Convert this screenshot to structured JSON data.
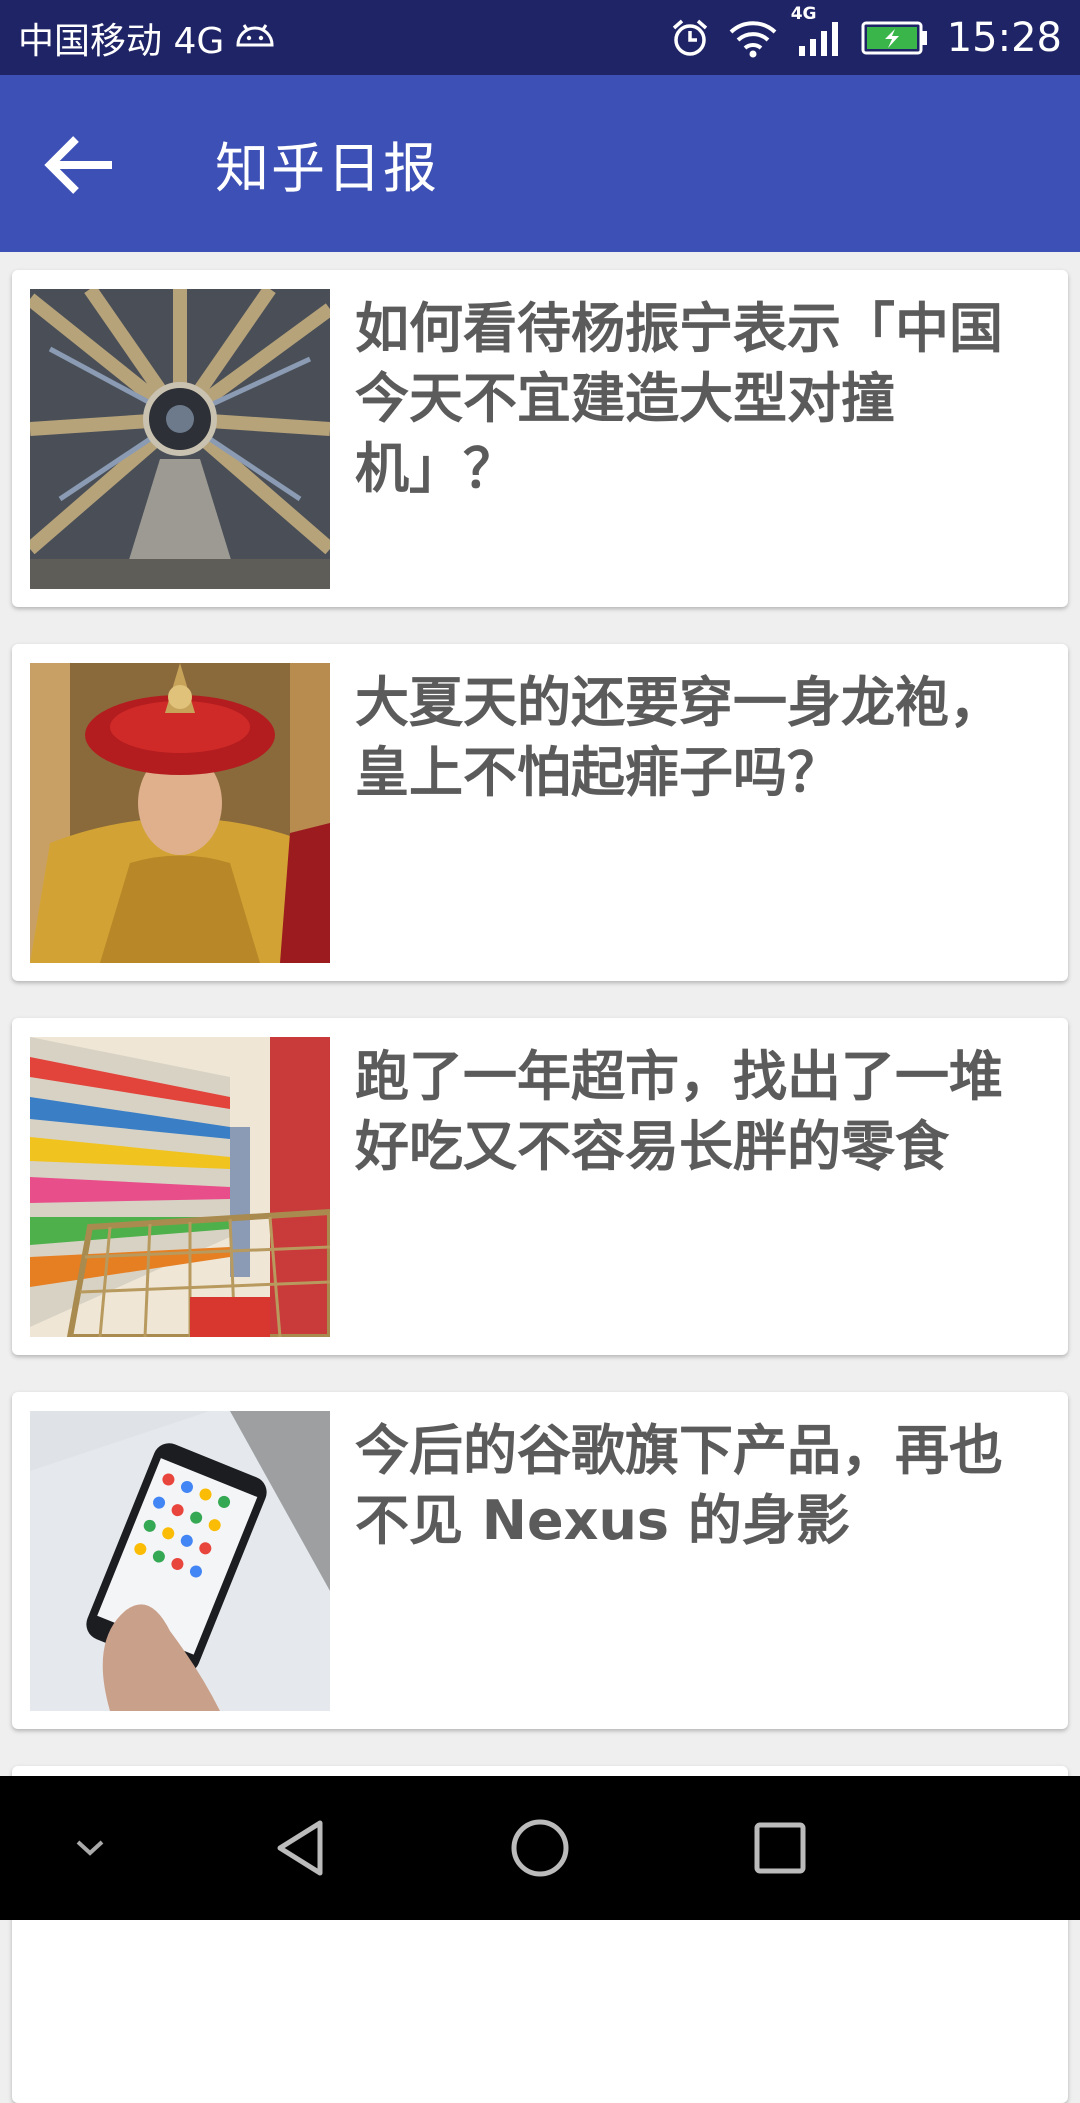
{
  "status_bar": {
    "carrier": "中国移动 4G",
    "network_badge": "4G",
    "time": "15:28",
    "icons": [
      "android-icon",
      "alarm-icon",
      "wifi-icon",
      "signal-icon",
      "battery-charging-icon"
    ]
  },
  "app_bar": {
    "title": "知乎日报",
    "back_icon": "arrow-left-icon"
  },
  "stories": [
    {
      "title": "如何看待杨振宁表示「中国今天不宜建造大型对撞机」？",
      "image": "particle-collider-photo"
    },
    {
      "title": "大夏天的还要穿一身龙袍，皇上不怕起痱子吗？",
      "image": "emperor-in-dragon-robe-photo"
    },
    {
      "title": "跑了一年超市，找出了一堆好吃又不容易长胖的零食",
      "image": "supermarket-aisle-photo"
    },
    {
      "title": "今后的谷歌旗下产品，再也不见 Nexus 的身影",
      "image": "hand-holding-smartphone-photo"
    }
  ],
  "nav_bar": {
    "icons": [
      "chevron-down-icon",
      "back-triangle-icon",
      "home-circle-icon",
      "recents-square-icon"
    ]
  },
  "colors": {
    "status_bar": "#1f2466",
    "app_bar": "#3d50b5",
    "background": "#efefef",
    "title_text": "#5b5b5b"
  }
}
